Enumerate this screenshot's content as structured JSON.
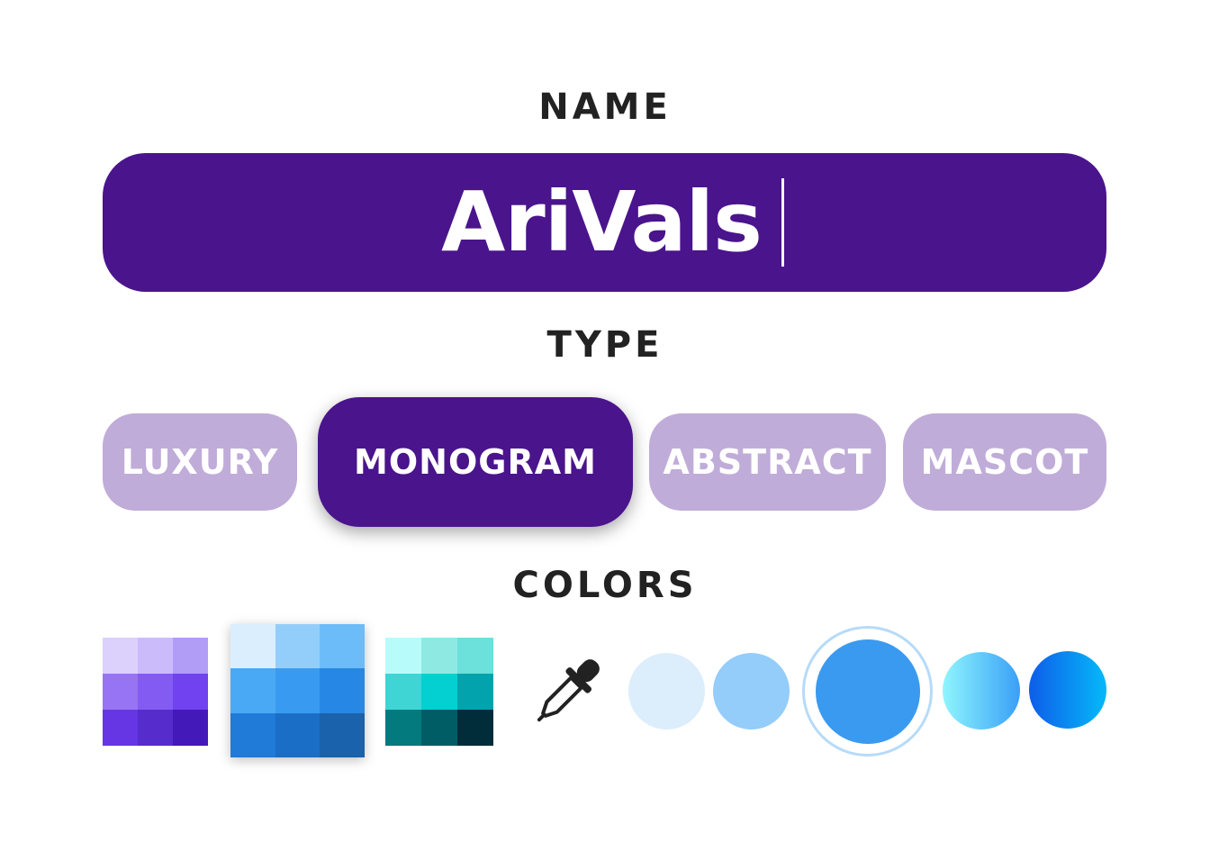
{
  "name_section": {
    "label": "NAME",
    "value": "AriVals",
    "field_color": "#4a148c"
  },
  "type_section": {
    "label": "TYPE",
    "selected": "MONOGRAM",
    "selected_color": "#4a148c",
    "unselected_color": "#c0acd8",
    "options": [
      {
        "label": "LUXURY"
      },
      {
        "label": "MONOGRAM"
      },
      {
        "label": "ABSTRACT"
      },
      {
        "label": "MASCOT"
      }
    ]
  },
  "colors_section": {
    "label": "COLORS",
    "palettes": [
      {
        "name": "purple",
        "selected": false,
        "swatches": [
          "#dcd0fd",
          "#cbbbfb",
          "#b19cf6",
          "#9774f3",
          "#845bf2",
          "#7042f0",
          "#6636e5",
          "#562ccd",
          "#431ab9"
        ]
      },
      {
        "name": "blue",
        "selected": true,
        "swatches": [
          "#dbeefd",
          "#93cefa",
          "#6cbcf9",
          "#4aa9f4",
          "#389bf1",
          "#2688e4",
          "#1f7ad8",
          "#1b6ec6",
          "#1a62ac"
        ]
      },
      {
        "name": "teal",
        "selected": false,
        "swatches": [
          "#b7fcfb",
          "#8fe9e3",
          "#6ce0db",
          "#3fd5d5",
          "#04cfd1",
          "#02a3ac",
          "#027a7e",
          "#005d65",
          "#012c3a"
        ]
      }
    ],
    "eyedropper_icon": "eyedropper-icon",
    "dots": [
      {
        "fill": "#dcedfc",
        "selected": false
      },
      {
        "fill": "#94ccfa",
        "selected": false
      },
      {
        "fill": "#399af0",
        "selected": true,
        "ring": "#b6dbf8"
      },
      {
        "fill": "linear-gradient(90deg, #8ff6fd 0%, #3a9ff7 100%)",
        "selected": false
      },
      {
        "fill": "linear-gradient(90deg, #0e5de9 0%, #05b9f9 100%)",
        "selected": false
      }
    ]
  }
}
